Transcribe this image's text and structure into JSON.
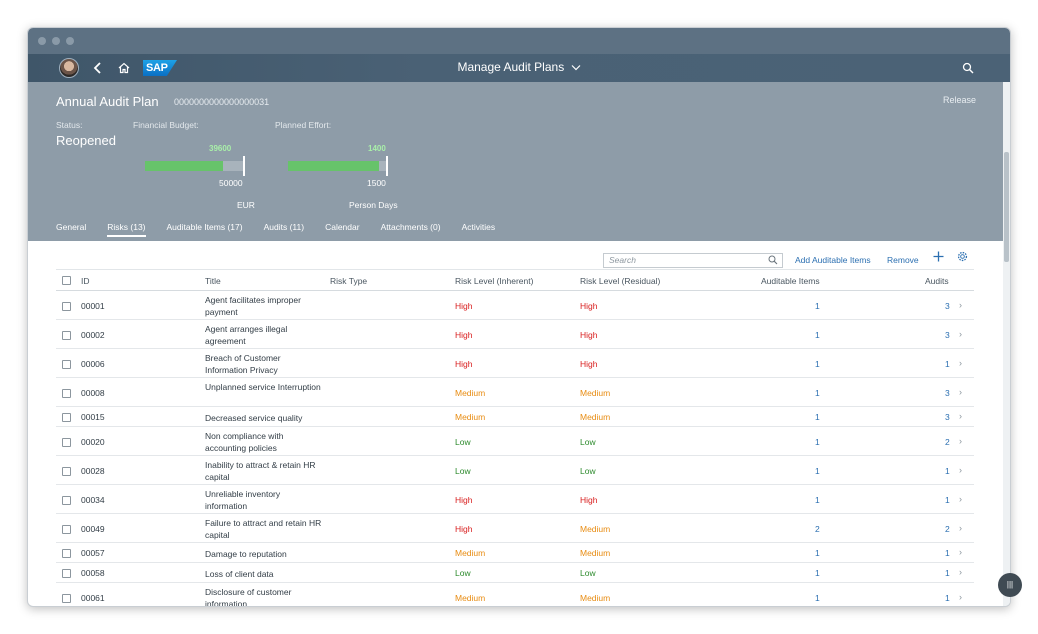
{
  "shell": {
    "title": "Manage Audit Plans",
    "logo_text": "SAP",
    "icons": [
      "avatar",
      "back-icon",
      "home-icon",
      "chevron-down-icon",
      "search-icon"
    ]
  },
  "header": {
    "title": "Annual Audit Plan",
    "object_id": "0000000000000000031",
    "release_label": "Release",
    "status_label": "Status:",
    "status_value": "Reopened",
    "budget_label": "Financial Budget:",
    "effort_label": "Planned Effort:",
    "budget": {
      "value": "39600",
      "max": "50000",
      "unit": "EUR",
      "fraction": 0.792
    },
    "effort": {
      "value": "1400",
      "max": "1500",
      "unit": "Person Days",
      "fraction": 0.933
    }
  },
  "tabs": [
    {
      "label": "General",
      "active": false
    },
    {
      "label": "Risks (13)",
      "active": true
    },
    {
      "label": "Auditable Items (17)",
      "active": false
    },
    {
      "label": "Audits (11)",
      "active": false
    },
    {
      "label": "Calendar",
      "active": false
    },
    {
      "label": "Attachments (0)",
      "active": false
    },
    {
      "label": "Activities",
      "active": false
    }
  ],
  "toolbar": {
    "search_placeholder": "Search",
    "add_label": "Add Auditable Items",
    "remove_label": "Remove"
  },
  "table": {
    "columns": {
      "id": "ID",
      "title": "Title",
      "risk_type": "Risk Type",
      "inherent": "Risk Level (Inherent)",
      "residual": "Risk Level (Residual)",
      "auditable_items": "Auditable Items",
      "audits": "Audits"
    },
    "rows": [
      {
        "id": "00001",
        "title": "Agent facilitates improper payment",
        "inherent": "High",
        "residual": "High",
        "items": "1",
        "audits": "3"
      },
      {
        "id": "00002",
        "title": "Agent arranges illegal agreement",
        "inherent": "High",
        "residual": "High",
        "items": "1",
        "audits": "3"
      },
      {
        "id": "00006",
        "title": "Breach of Customer Information Privacy",
        "inherent": "High",
        "residual": "High",
        "items": "1",
        "audits": "1"
      },
      {
        "id": "00008",
        "title": "Unplanned service Interruption",
        "inherent": "Medium",
        "residual": "Medium",
        "items": "1",
        "audits": "3"
      },
      {
        "id": "00015",
        "title": "Decreased service quality",
        "inherent": "Medium",
        "residual": "Medium",
        "items": "1",
        "audits": "3"
      },
      {
        "id": "00020",
        "title": "Non compliance with accounting policies",
        "inherent": "Low",
        "residual": "Low",
        "items": "1",
        "audits": "2"
      },
      {
        "id": "00028",
        "title": "Inability to attract & retain HR capital",
        "inherent": "Low",
        "residual": "Low",
        "items": "1",
        "audits": "1"
      },
      {
        "id": "00034",
        "title": "Unreliable inventory information",
        "inherent": "High",
        "residual": "High",
        "items": "1",
        "audits": "1"
      },
      {
        "id": "00049",
        "title": "Failure to attract and retain HR capital",
        "inherent": "High",
        "residual": "Medium",
        "items": "2",
        "audits": "2"
      },
      {
        "id": "00057",
        "title": "Damage to reputation",
        "inherent": "Medium",
        "residual": "Medium",
        "items": "1",
        "audits": "1"
      },
      {
        "id": "00058",
        "title": "Loss of client data",
        "inherent": "Low",
        "residual": "Low",
        "items": "1",
        "audits": "1"
      },
      {
        "id": "00061",
        "title": "Disclosure of customer information",
        "inherent": "Medium",
        "residual": "Medium",
        "items": "1",
        "audits": "1"
      }
    ]
  },
  "colors": {
    "shell": "#4a6175",
    "header": "#8e9ca8",
    "high": "#d81e1e",
    "medium": "#e88c12",
    "low": "#2c8a2c",
    "link": "#2b6fb1",
    "bar_fill": "#67c36a"
  }
}
